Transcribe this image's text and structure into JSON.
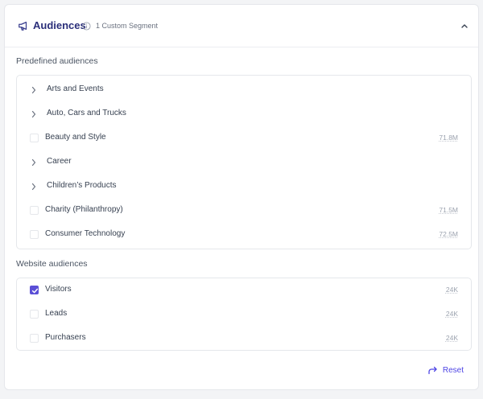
{
  "header": {
    "title": "Audiences",
    "segment_info": "1 Custom Segment",
    "icons": [
      "megaphone-icon",
      "info-icon",
      "chevron-up-icon"
    ]
  },
  "predefined": {
    "label": "Predefined audiences",
    "items": [
      {
        "label": "Arts and Events",
        "type": "group"
      },
      {
        "label": "Auto, Cars and Trucks",
        "type": "group"
      },
      {
        "label": "Beauty and Style",
        "type": "option",
        "count": "71.8M",
        "checked": false
      },
      {
        "label": "Career",
        "type": "group"
      },
      {
        "label": "Children’s Products",
        "type": "group"
      },
      {
        "label": "Charity (Philanthropy)",
        "type": "option",
        "count": "71.5M",
        "checked": false
      },
      {
        "label": "Consumer Technology",
        "type": "option",
        "count": "72.5M",
        "checked": false
      }
    ]
  },
  "website": {
    "label": "Website audiences",
    "items": [
      {
        "label": "Visitors",
        "count": "24K",
        "checked": true
      },
      {
        "label": "Leads",
        "count": "24K",
        "checked": false
      },
      {
        "label": "Purchasers",
        "count": "24K",
        "checked": false
      }
    ]
  },
  "footer": {
    "reset_label": "Reset"
  },
  "colors": {
    "title": "#2b2f7a",
    "accent": "#5b4fd6",
    "link": "#4f46e5"
  }
}
